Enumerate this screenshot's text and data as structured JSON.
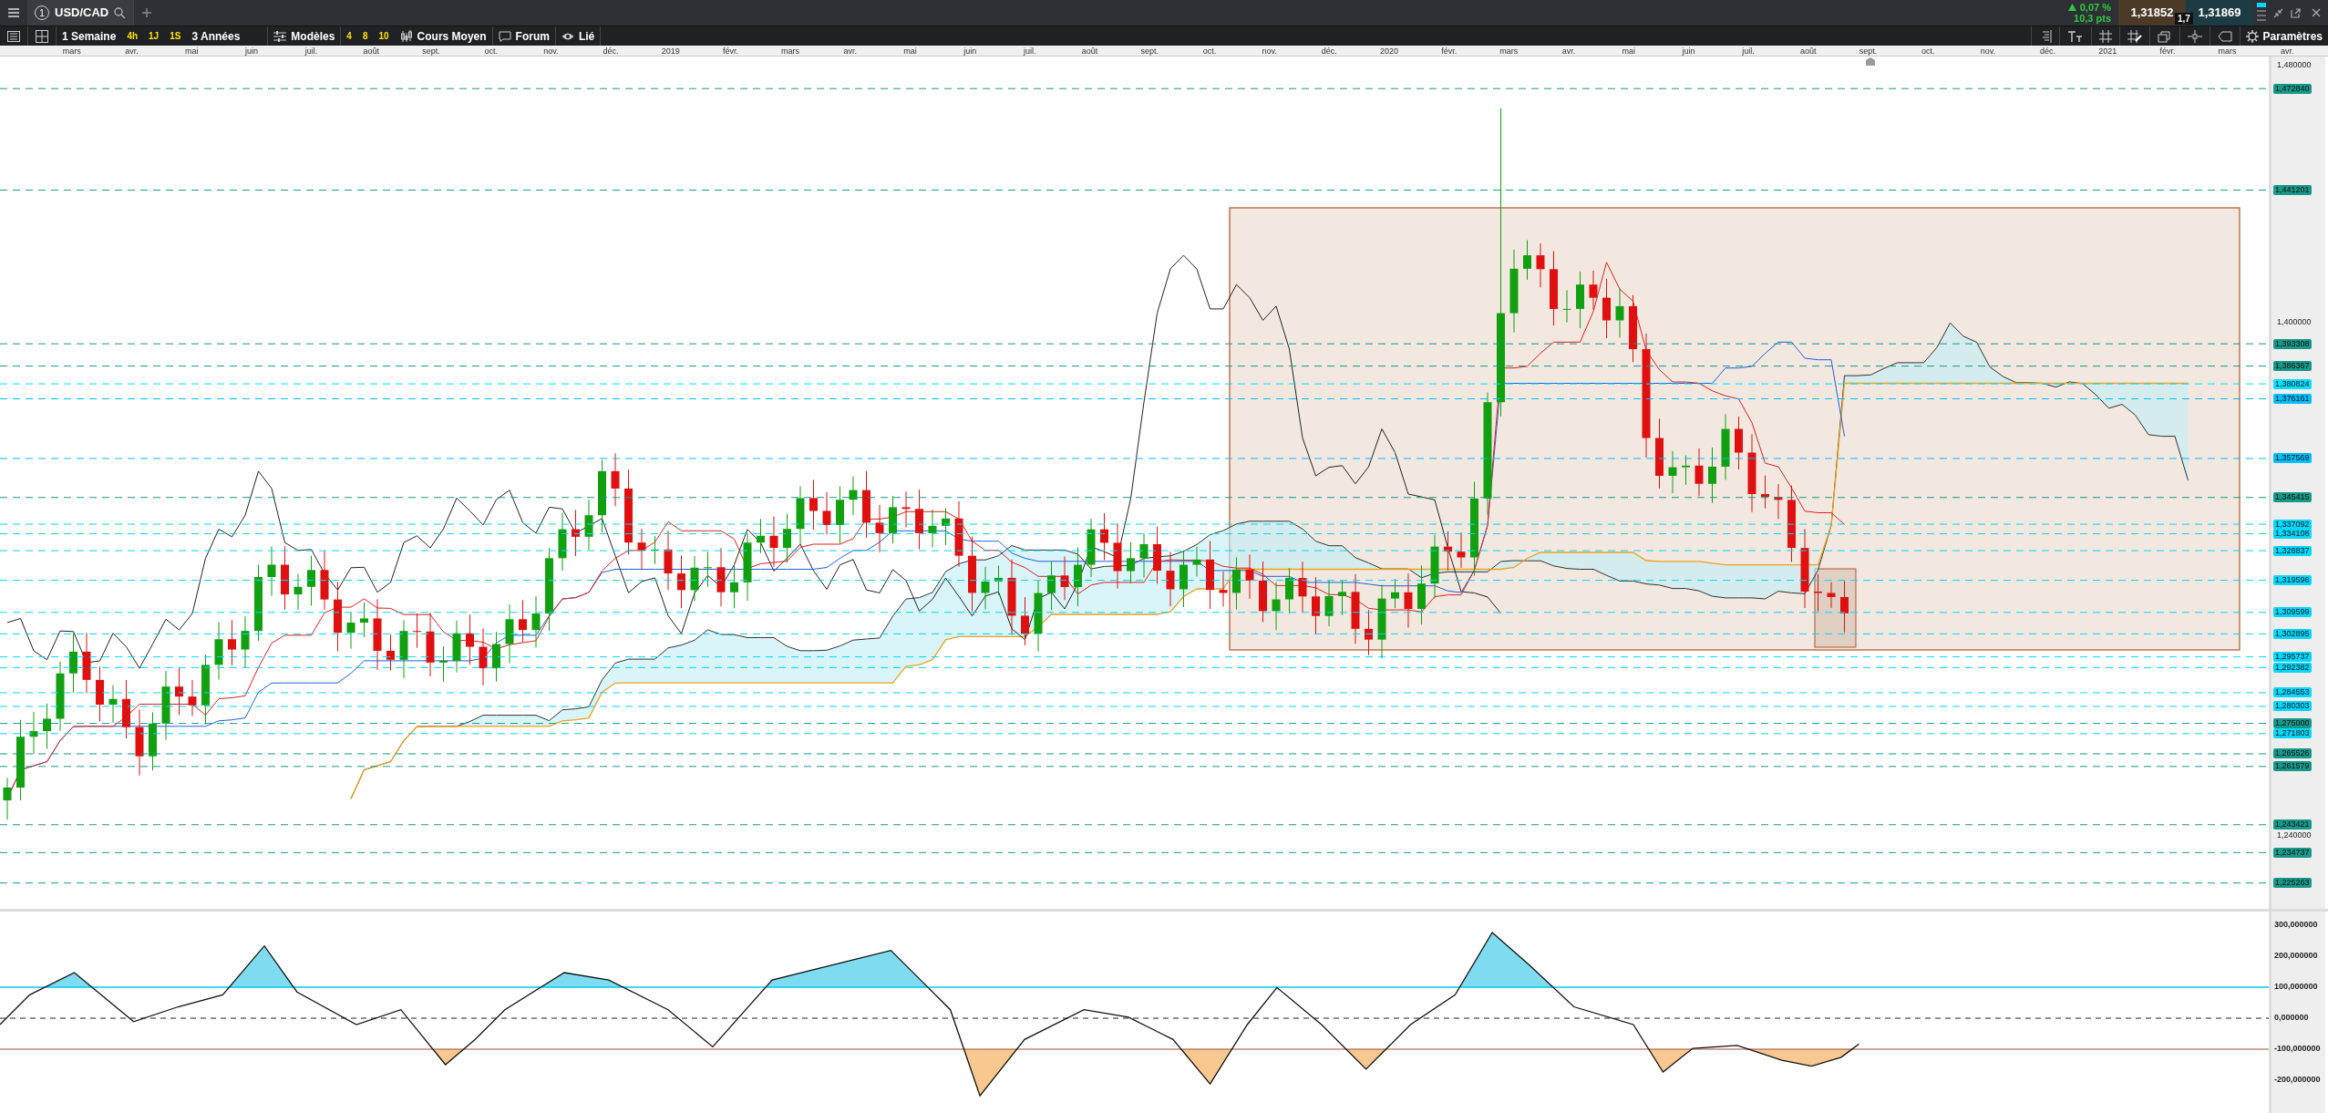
{
  "tabs": [
    {
      "number": "1",
      "label": "USD/CAD",
      "selected": true
    }
  ],
  "quote": {
    "change": "0,07 %",
    "points": "10,3 pts",
    "bid": "1,31852",
    "ask": "1,31869",
    "spread": "1,7"
  },
  "toolbar": {
    "period": "1 Semaine",
    "quick_periods": [
      "4h",
      "1J",
      "1S"
    ],
    "range": "3 Années",
    "templates": "Modèles",
    "layouts": [
      "4",
      "8",
      "10"
    ],
    "chart_type": "Cours Moyen",
    "forum": "Forum",
    "linked": "Lié",
    "settings": "Paramètres"
  },
  "time_axis": [
    "mars",
    "avr.",
    "mai",
    "juin",
    "juil.",
    "août",
    "sept.",
    "oct.",
    "nov.",
    "déc.",
    "2019",
    "févr.",
    "mars",
    "avr.",
    "mai",
    "juin",
    "juil.",
    "août",
    "sept.",
    "oct.",
    "nov.",
    "déc.",
    "2020",
    "févr.",
    "mars",
    "avr.",
    "mai",
    "juin",
    "juil.",
    "août",
    "sept.",
    "oct.",
    "nov.",
    "déc.",
    "2021",
    "févr.",
    "mars",
    "avr."
  ],
  "price_axis": {
    "ticks": [
      "1,480000",
      "1,400000",
      "1,240000"
    ],
    "levels": [
      {
        "value": "1,472840",
        "color": "#17998a"
      },
      {
        "value": "1,441201",
        "color": "#17998a"
      },
      {
        "value": "1,393308",
        "color": "#17998a"
      },
      {
        "value": "1,386367",
        "color": "#17998a"
      },
      {
        "value": "1,380824",
        "color": "#00e0ff"
      },
      {
        "value": "1,376161",
        "color": "#00bfff"
      },
      {
        "value": "1,357569",
        "color": "#00bfff"
      },
      {
        "value": "1,345415",
        "color": "#17998a"
      },
      {
        "value": "1,337092",
        "color": "#00d8ff"
      },
      {
        "value": "1,334108",
        "color": "#00d8ff"
      },
      {
        "value": "1,328837",
        "color": "#00d8ff"
      },
      {
        "value": "1,319596",
        "color": "#00d8ff"
      },
      {
        "value": "1,309599",
        "color": "#00d8ff"
      },
      {
        "value": "1,302895",
        "color": "#00d8ff"
      },
      {
        "value": "1,295737",
        "color": "#00d8ff"
      },
      {
        "value": "1,292382",
        "color": "#00d8ff"
      },
      {
        "value": "1,284553",
        "color": "#00d8ff"
      },
      {
        "value": "1,280303",
        "color": "#00d8ff"
      },
      {
        "value": "1,275000",
        "color": "#17998a"
      },
      {
        "value": "1,271803",
        "color": "#00d8ff"
      },
      {
        "value": "1,265526",
        "color": "#17998a"
      },
      {
        "value": "1,261579",
        "color": "#17998a"
      },
      {
        "value": "1,243421",
        "color": "#17998a"
      },
      {
        "value": "1,234737",
        "color": "#17998a"
      },
      {
        "value": "1,225263",
        "color": "#17998a"
      }
    ]
  },
  "oscillator_axis": {
    "ticks": [
      "300,000000",
      "200,000000",
      "100,000000",
      "0,000000",
      "-100,000000",
      "-200,000000"
    ]
  }
}
